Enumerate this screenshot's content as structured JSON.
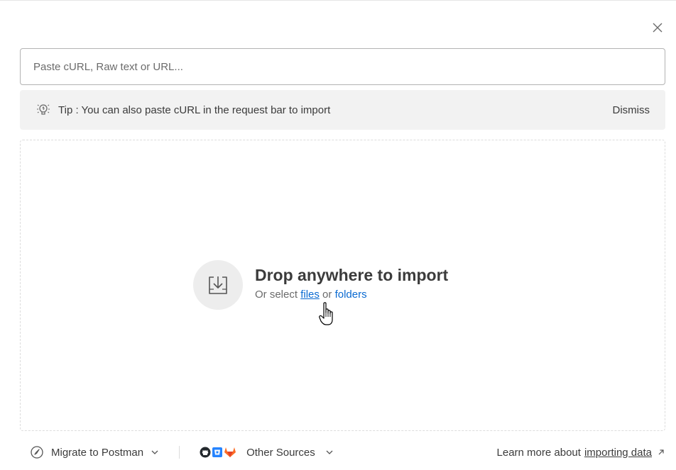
{
  "dialog": {
    "close_icon": "close-icon"
  },
  "input": {
    "placeholder": "Paste cURL, Raw text or URL...",
    "value": ""
  },
  "tip": {
    "icon": "lightbulb-icon",
    "text": "Tip : You can also paste cURL in the request bar to import",
    "dismiss_label": "Dismiss"
  },
  "drop": {
    "icon": "import-tray-icon",
    "title": "Drop anywhere to import",
    "subtitle_prefix": "Or select",
    "files_link": "files",
    "or_text": "or",
    "folders_link": "folders"
  },
  "footer": {
    "migrate_label": "Migrate to Postman",
    "other_sources_label": "Other Sources",
    "learn_prefix": "Learn more about",
    "learn_link": "importing data"
  },
  "colors": {
    "link": "#0a6ad1",
    "tip_background": "#f2f2f2",
    "github": "#24292e",
    "bitbucket": "#2684ff",
    "gitlab": "#fc6d26"
  }
}
